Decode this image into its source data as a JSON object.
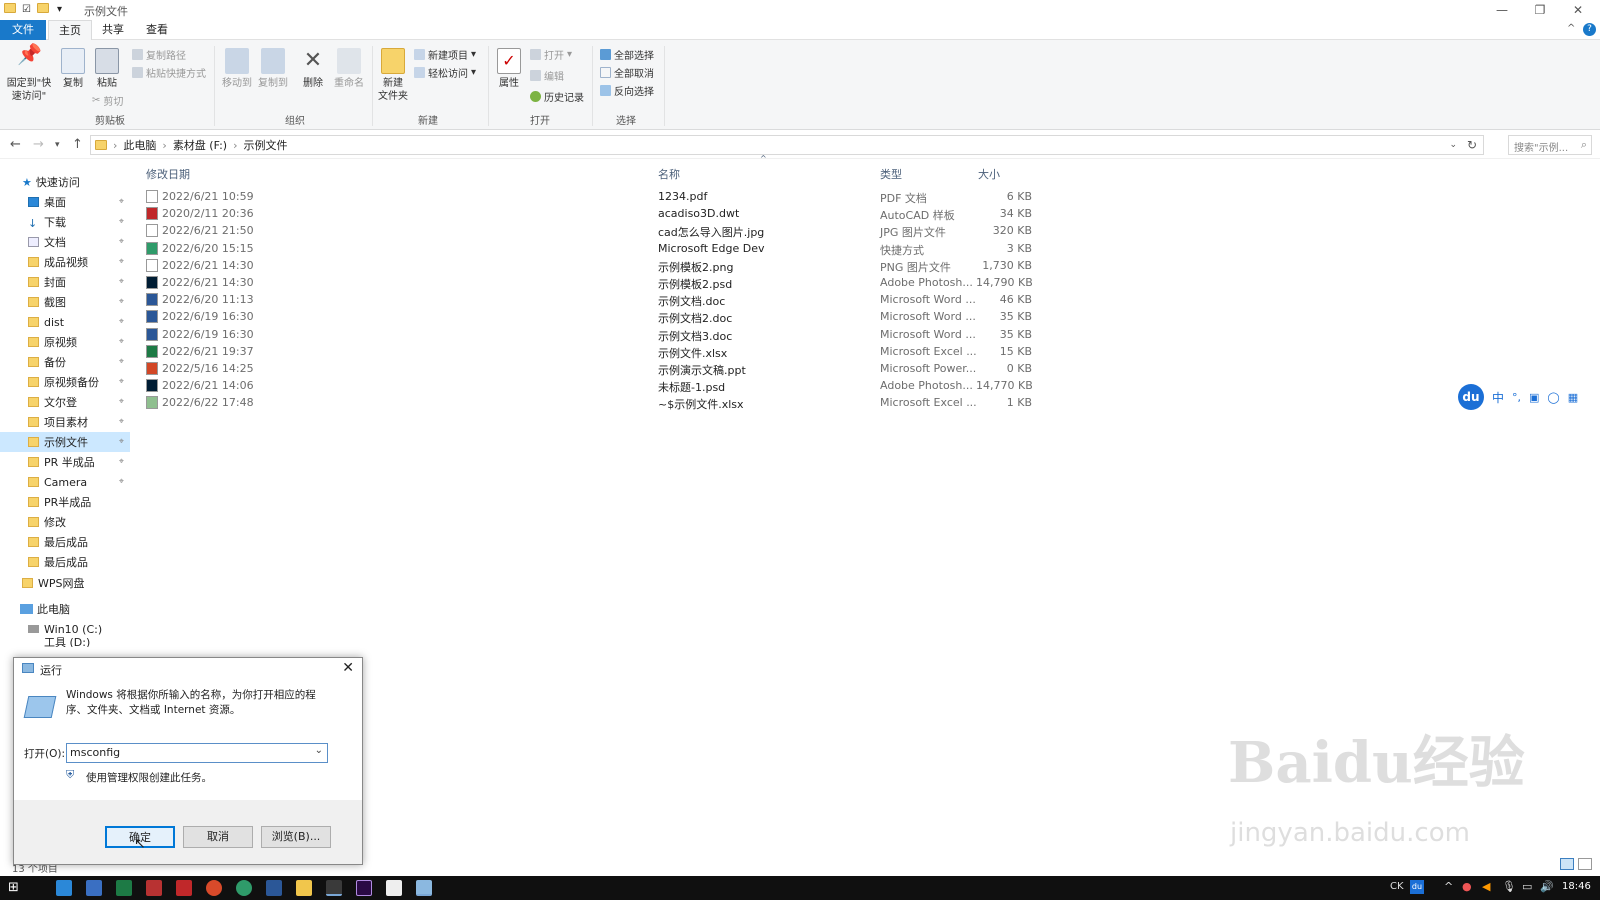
{
  "window": {
    "title": "示例文件"
  },
  "tabs": {
    "file": "文件",
    "home": "主页",
    "share": "共享",
    "view": "查看"
  },
  "ribbon": {
    "pin": "固定到\"快速访问\"",
    "copy": "复制",
    "paste": "粘贴",
    "copy_path": "复制路径",
    "paste_shortcut": "粘贴快捷方式",
    "cut": "剪切",
    "move_to": "移动到",
    "copy_to": "复制到",
    "delete": "删除",
    "rename": "重命名",
    "new_folder": "新建\n文件夹",
    "new_item": "新建项目",
    "easy_access": "轻松访问",
    "properties": "属性",
    "open": "打开",
    "edit": "编辑",
    "history": "历史记录",
    "select_all": "全部选择",
    "select_none": "全部取消",
    "invert": "反向选择",
    "groups": {
      "clipboard": "剪贴板",
      "organize": "组织",
      "new": "新建",
      "open": "打开",
      "select": "选择"
    }
  },
  "address": {
    "crumbs": [
      "此电脑",
      "素材盘 (F:)",
      "示例文件"
    ],
    "search_placeholder": "搜索\"示例..."
  },
  "nav": {
    "quick_access": "快速访问",
    "items": [
      {
        "label": "桌面"
      },
      {
        "label": "下载"
      },
      {
        "label": "文档"
      },
      {
        "label": "成品视频"
      },
      {
        "label": "封面"
      },
      {
        "label": "截图"
      },
      {
        "label": "dist"
      },
      {
        "label": "原视频"
      },
      {
        "label": "备份"
      },
      {
        "label": "原视频备份"
      },
      {
        "label": "文尔登"
      },
      {
        "label": "项目素材"
      },
      {
        "label": "示例文件"
      },
      {
        "label": "PR 半成品"
      },
      {
        "label": "Camera"
      },
      {
        "label": "PR半成品"
      },
      {
        "label": "修改"
      },
      {
        "label": "最后成品"
      },
      {
        "label": "最后成品"
      }
    ],
    "wps": "WPS网盘",
    "this_pc": "此电脑",
    "drive_c": "Win10 (C:)",
    "drive_d": "工具 (D:)"
  },
  "columns": {
    "date": "修改日期",
    "name": "名称",
    "type": "类型",
    "size": "大小"
  },
  "files": [
    {
      "date": "2022/6/21 10:59",
      "name": "1234.pdf",
      "type": "PDF 文档",
      "size": "6 KB"
    },
    {
      "date": "2020/2/11 20:36",
      "name": "acadiso3D.dwt",
      "type": "AutoCAD 样板",
      "size": "34 KB"
    },
    {
      "date": "2022/6/21 21:50",
      "name": "cad怎么导入图片.jpg",
      "type": "JPG 图片文件",
      "size": "320 KB"
    },
    {
      "date": "2022/6/20 15:15",
      "name": "Microsoft Edge Dev",
      "type": "快捷方式",
      "size": "3 KB"
    },
    {
      "date": "2022/6/21 14:30",
      "name": "示例模板2.png",
      "type": "PNG 图片文件",
      "size": "1,730 KB"
    },
    {
      "date": "2022/6/21 14:30",
      "name": "示例模板2.psd",
      "type": "Adobe Photosh...",
      "size": "14,790 KB"
    },
    {
      "date": "2022/6/20 11:13",
      "name": "示例文档.doc",
      "type": "Microsoft Word ...",
      "size": "46 KB"
    },
    {
      "date": "2022/6/19 16:30",
      "name": "示例文档2.doc",
      "type": "Microsoft Word ...",
      "size": "35 KB"
    },
    {
      "date": "2022/6/19 16:30",
      "name": "示例文档3.doc",
      "type": "Microsoft Word ...",
      "size": "35 KB"
    },
    {
      "date": "2022/6/21 19:37",
      "name": "示例文件.xlsx",
      "type": "Microsoft Excel ...",
      "size": "15 KB"
    },
    {
      "date": "2022/5/16 14:25",
      "name": "示例演示文稿.ppt",
      "type": "Microsoft Power...",
      "size": "0 KB"
    },
    {
      "date": "2022/6/21 14:06",
      "name": "未标题-1.psd",
      "type": "Adobe Photosh...",
      "size": "14,770 KB"
    },
    {
      "date": "2022/6/22 17:48",
      "name": "~$示例文件.xlsx",
      "type": "Microsoft Excel ...",
      "size": "1 KB"
    }
  ],
  "status": {
    "count": "13 个项目"
  },
  "run": {
    "title": "运行",
    "desc": "Windows 将根据你所输入的名称，为你打开相应的程序、文件夹、文档或 Internet 资源。",
    "open_label": "打开(O):",
    "value": "msconfig",
    "admin": "使用管理权限创建此任务。",
    "ok": "确定",
    "cancel": "取消",
    "browse": "浏览(B)..."
  },
  "taskbar": {
    "time": "18:46",
    "lang": "CK"
  },
  "ime": {
    "zh": "中",
    "logo": "du"
  },
  "watermark": {
    "main": "Baidu经验",
    "sub": "jingyan.baidu.com"
  }
}
